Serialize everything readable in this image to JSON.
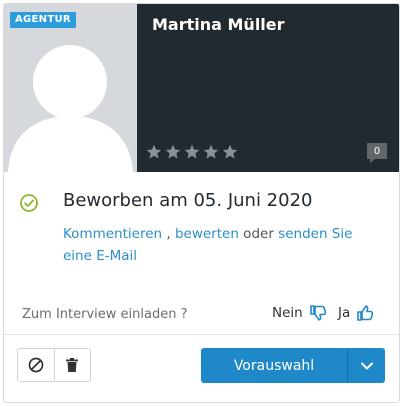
{
  "candidate": {
    "badge": "AGENTUR",
    "name": "Martina Müller",
    "rating": 0,
    "rating_max": 5,
    "comment_count": "0"
  },
  "status": {
    "text": "Beworben am 05. Juni 2020"
  },
  "actions": {
    "comment": "Kommentieren",
    "separator": " , ",
    "rate": "bewerten",
    "or": " oder ",
    "email": "senden Sie eine E-Mail"
  },
  "interview": {
    "question": "Zum Interview einladen ?",
    "no_label": "Nein",
    "yes_label": "Ja"
  },
  "footer": {
    "primary_label": "Vorauswahl"
  },
  "icons": {
    "status": "check-circle-icon",
    "reject": "ban-icon",
    "delete": "trash-icon",
    "no": "thumbs-down-icon",
    "yes": "thumbs-up-icon",
    "dropdown": "chevron-down-icon",
    "comments": "speech-bubble-icon",
    "rating": "star-icon"
  },
  "colors": {
    "accent": "#1e88c8",
    "link": "#2c8fc9",
    "badge": "#2c9cda",
    "header_dark": "#222a31",
    "status_check": "#8ab833"
  }
}
